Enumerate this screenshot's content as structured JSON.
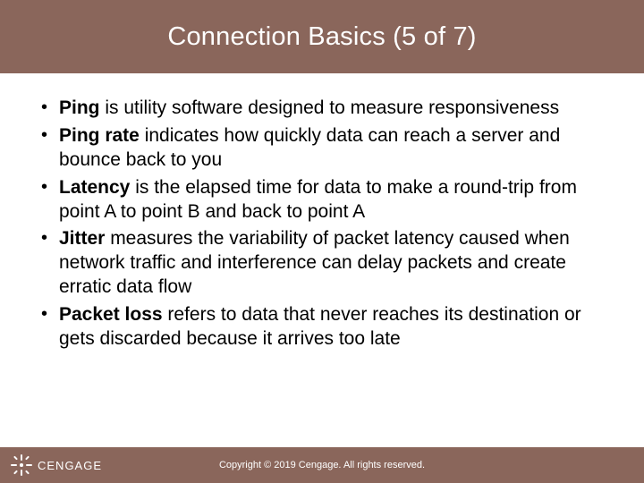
{
  "title": "Connection Basics (5 of 7)",
  "bullets": [
    {
      "term": "Ping",
      "rest": " is utility software designed to measure responsiveness"
    },
    {
      "term": "Ping rate",
      "rest": " indicates how quickly data can reach a server and bounce back to you"
    },
    {
      "term": "Latency",
      "rest": " is the elapsed time for data to make a round-trip from point A to point B and back to point A"
    },
    {
      "term": "Jitter",
      "rest": " measures the variability of packet latency caused when network traffic and interference can delay packets and create erratic data flow"
    },
    {
      "term": "Packet loss",
      "rest": " refers to data that never reaches its destination or gets discarded because it arrives too late"
    }
  ],
  "footer": {
    "brand": "CENGAGE",
    "copyright": "Copyright © 2019 Cengage. All rights reserved."
  },
  "colors": {
    "band": "#8a665b"
  }
}
